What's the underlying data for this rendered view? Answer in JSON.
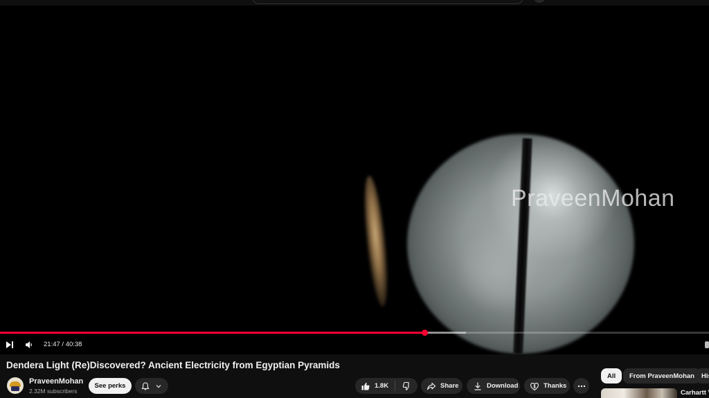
{
  "player": {
    "watermark": "PraveenMohan",
    "time_display": "21:47 / 40:38",
    "progress": {
      "played_fraction": 0.599,
      "buffered_fraction": 0.657
    }
  },
  "video": {
    "title": "Dendera Light (Re)Discovered? Ancient Electricity from Egyptian Pyramids"
  },
  "channel": {
    "name": "PraveenMohan",
    "subscribers": "2.32M subscribers",
    "see_perks_label": "See perks"
  },
  "actions": {
    "like_count": "1.8K",
    "share_label": "Share",
    "download_label": "Download",
    "thanks_label": "Thanks"
  },
  "chips": [
    "All",
    "From PraveenMohan",
    "His"
  ],
  "recommendation": {
    "title": "Carhartt V"
  },
  "colors": {
    "accent": "#ff0033",
    "background": "#0f0f0f",
    "pill": "#272727"
  }
}
